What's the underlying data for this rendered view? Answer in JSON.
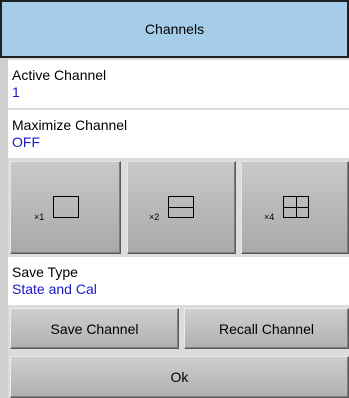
{
  "header": {
    "title": "Channels"
  },
  "active_channel": {
    "label": "Active Channel",
    "value": "1"
  },
  "maximize_channel": {
    "label": "Maximize Channel",
    "value": "OFF"
  },
  "layout_tiles": [
    {
      "multiplier": "×1",
      "icon": "single-window-icon"
    },
    {
      "multiplier": "×2",
      "icon": "two-horizontal-windows-icon"
    },
    {
      "multiplier": "×4",
      "icon": "four-grid-windows-icon"
    }
  ],
  "save_type": {
    "label": "Save Type",
    "value": "State and Cal"
  },
  "buttons": {
    "save_channel": "Save Channel",
    "recall_channel": "Recall Channel",
    "ok": "Ok"
  },
  "colors": {
    "header_bg": "#a5cde9",
    "value_text": "#1a17c9"
  }
}
